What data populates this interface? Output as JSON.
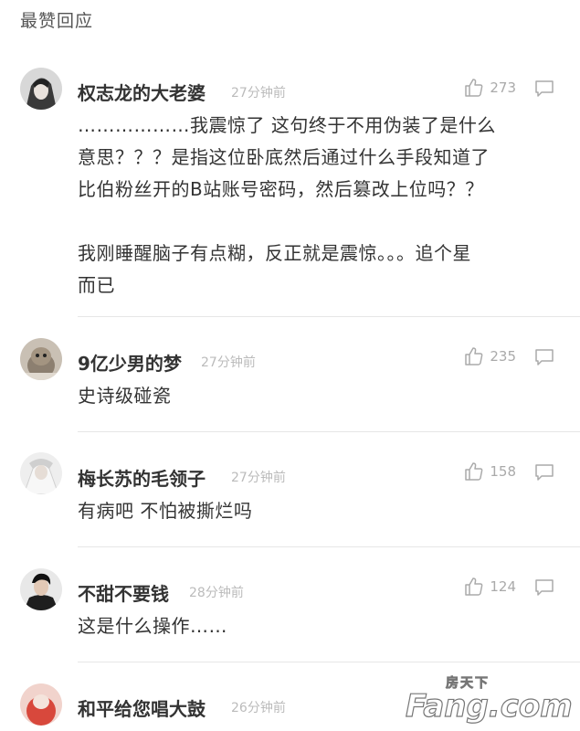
{
  "section": {
    "title": "最赞回应"
  },
  "comments": [
    {
      "username": "权志龙的大老婆",
      "time": "27分钟前",
      "likes": "273",
      "text_lines": [
        "………………我震惊了 这句终于不用伪装了是什么",
        "意思？？？是指这位卧底然后通过什么手段知道了",
        "比伯粉丝开的B站账号密码，然后篡改上位吗？？"
      ],
      "text_lines_2": [
        "我刚睡醒脑子有点糊，反正就是震惊。。。追个星",
        "而已"
      ]
    },
    {
      "username": "9亿少男的梦",
      "time": "27分钟前",
      "likes": "235",
      "text": "史诗级碰瓷"
    },
    {
      "username": "梅长苏的毛领子",
      "time": "27分钟前",
      "likes": "158",
      "text": "有病吧 不怕被撕烂吗"
    },
    {
      "username": "不甜不要钱",
      "time": "28分钟前",
      "likes": "124",
      "text": "这是什么操作……"
    },
    {
      "username": "和平给您唱大鼓",
      "time": "26分钟前"
    }
  ],
  "watermark": {
    "text": "Fang.com",
    "sub": "房天下"
  },
  "icons": {
    "like": "thumbs-up-icon",
    "reply": "comment-bubble-icon"
  },
  "colors": {
    "meta": "#bbbbbb",
    "text": "#333333",
    "divider": "#e6e6e6"
  }
}
